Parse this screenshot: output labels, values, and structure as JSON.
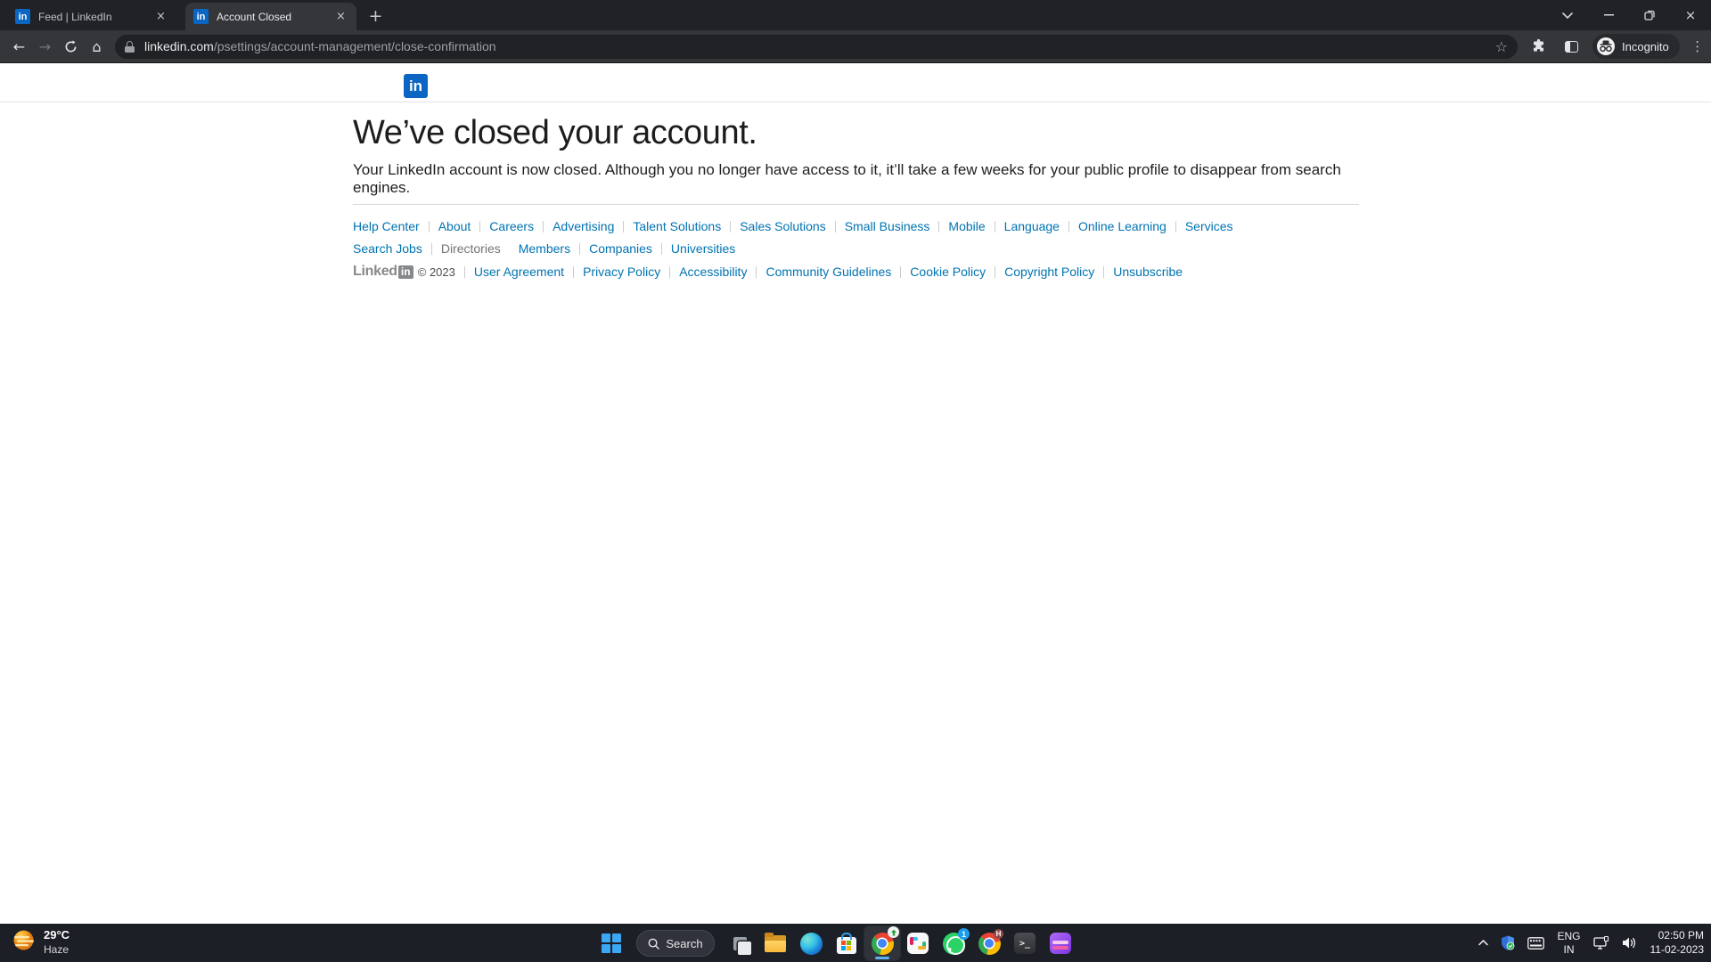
{
  "browser": {
    "tabs": {
      "tab1_title": "Feed | LinkedIn",
      "tab2_title": "Account Closed",
      "favicon_text": "in"
    },
    "url": {
      "domain": "linkedin.com",
      "path": "/psettings/account-management/close-confirmation"
    },
    "incognito_label": "Incognito",
    "glyphs": {
      "back": "←",
      "forward": "→",
      "home": "⌂",
      "star": "☆",
      "menu": "⋮",
      "new_tab": "+",
      "tab_close": "×",
      "window_close": "×"
    }
  },
  "page": {
    "logo_text": "in",
    "heading": "We’ve closed your account.",
    "subtext": "Your LinkedIn account is now closed. Although you no longer have access to it, it’ll take a few weeks for your public profile to disappear from search engines.",
    "footer": {
      "row1": [
        "Help Center",
        "About",
        "Careers",
        "Advertising",
        "Talent Solutions",
        "Sales Solutions",
        "Small Business",
        "Mobile",
        "Language",
        "Online Learning",
        "Services"
      ],
      "row2_link": "Search Jobs",
      "row2_label": "Directories",
      "row2_links": [
        "Members",
        "Companies",
        "Universities"
      ],
      "row3_brand": "Linked",
      "row3_brand_in": "in",
      "row3_copyright": "© 2023",
      "row3_links": [
        "User Agreement",
        "Privacy Policy",
        "Accessibility",
        "Community Guidelines",
        "Cookie Policy",
        "Copyright Policy",
        "Unsubscribe"
      ]
    }
  },
  "taskbar": {
    "weather": {
      "temp": "29°C",
      "condition": "Haze"
    },
    "search_label": "Search",
    "badges": {
      "whatsapp": "1",
      "chrome_profile": "H"
    },
    "terminal_glyph": ">_",
    "tray": {
      "lang_line1": "ENG",
      "lang_line2": "IN",
      "time": "02:50 PM",
      "date": "11-02-2023"
    }
  },
  "colors": {
    "linkedin_blue": "#0a66c2",
    "footer_link_blue": "#0073b1",
    "chrome_toolbar": "#35363a",
    "tabstrip": "#202227",
    "urlbar": "#202124",
    "taskbar_bg": "#1d1f27",
    "whatsapp_green": "#2bd366",
    "active_indicator": "#5fb2f2"
  }
}
